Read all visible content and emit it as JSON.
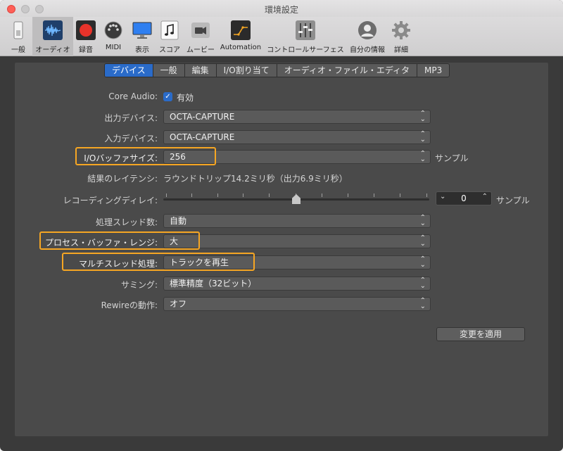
{
  "window": {
    "title": "環境設定"
  },
  "toolbar": {
    "items": [
      {
        "label": "一般"
      },
      {
        "label": "オーディオ"
      },
      {
        "label": "録音"
      },
      {
        "label": "MIDI"
      },
      {
        "label": "表示"
      },
      {
        "label": "スコア"
      },
      {
        "label": "ムービー"
      },
      {
        "label": "Automation"
      },
      {
        "label": "コントロールサーフェス"
      },
      {
        "label": "自分の情報"
      },
      {
        "label": "詳細"
      }
    ]
  },
  "tabs": [
    "デバイス",
    "一般",
    "編集",
    "I/O割り当て",
    "オーディオ・ファイル・エディタ",
    "MP3"
  ],
  "settings": {
    "core_audio": {
      "label": "Core Audio:",
      "value": "有効",
      "checked": "✓"
    },
    "output_device": {
      "label": "出力デバイス:",
      "value": "OCTA-CAPTURE"
    },
    "input_device": {
      "label": "入力デバイス:",
      "value": "OCTA-CAPTURE"
    },
    "io_buffer": {
      "label": "I/Oバッファサイズ:",
      "value": "256",
      "suffix": "サンプル"
    },
    "latency": {
      "label": "結果のレイテンシ:",
      "value": "ラウンドトリップ14.2ミリ秒（出力6.9ミリ秒）"
    },
    "recording_delay": {
      "label": "レコーディングディレイ:",
      "value": "0",
      "suffix": "サンプル",
      "slider_fraction": 0.5
    },
    "process_threads": {
      "label": "処理スレッド数:",
      "value": "自動"
    },
    "process_buffer": {
      "label": "プロセス・バッファ・レンジ:",
      "value": "大"
    },
    "multithread": {
      "label": "マルチスレッド処理:",
      "value": "トラックを再生"
    },
    "summing": {
      "label": "サミング:",
      "value": "標準精度（32ビット）"
    },
    "rewire": {
      "label": "Rewireの動作:",
      "value": "オフ"
    }
  },
  "apply_button": "変更を適用",
  "colors": {
    "accent": "#2a6bc9",
    "highlight": "#f6a623",
    "panel": "#4a4a4a"
  }
}
